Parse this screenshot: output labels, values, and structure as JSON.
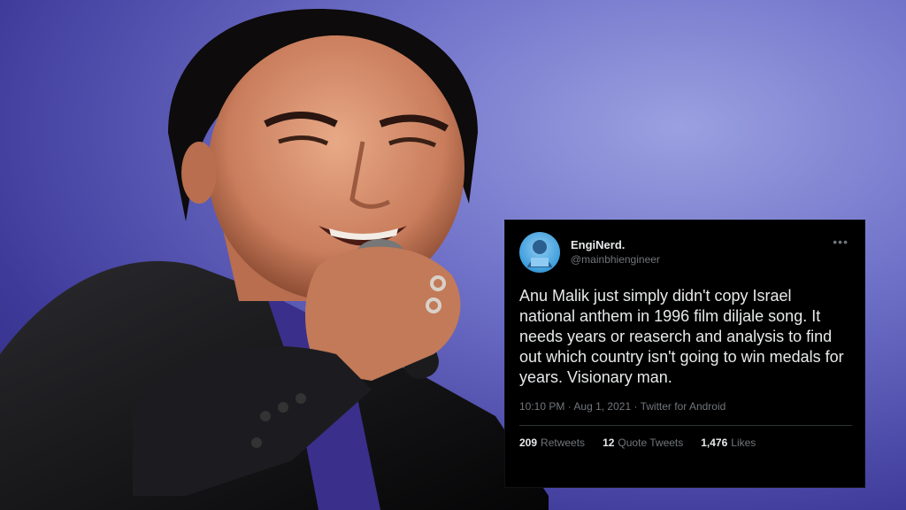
{
  "tweet": {
    "display_name": "EngiNerd.",
    "handle": "@mainbhiengineer",
    "more_icon": "more-horizontal-icon",
    "text": "Anu Malik just simply didn't copy Israel national anthem in 1996 film diljale song.  It needs years or reaserch and analysis to find out which country isn't going to win medals for years. Visionary man.",
    "time": "10:10 PM",
    "date": "Aug 1, 2021",
    "source": "Twitter for Android",
    "retweets_count": "209",
    "retweets_label": "Retweets",
    "quotes_count": "12",
    "quotes_label": "Quote Tweets",
    "likes_count": "1,476",
    "likes_label": "Likes"
  },
  "colors": {
    "background": "#5b5bb8",
    "tweet_bg": "#000000",
    "text": "#e7e9ea",
    "muted": "#71767b"
  }
}
